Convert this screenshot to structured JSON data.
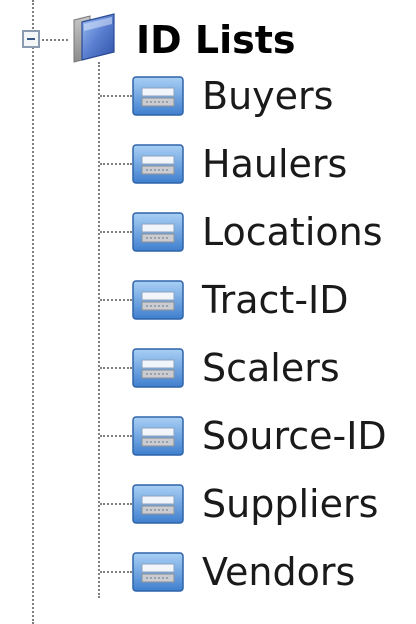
{
  "tree": {
    "root": {
      "label": "ID Lists",
      "icon": "folder-icon",
      "expanded": true
    },
    "items": [
      {
        "label": "Buyers",
        "icon": "list-icon"
      },
      {
        "label": "Haulers",
        "icon": "list-icon"
      },
      {
        "label": "Locations",
        "icon": "list-icon"
      },
      {
        "label": "Tract-ID",
        "icon": "list-icon"
      },
      {
        "label": "Scalers",
        "icon": "list-icon"
      },
      {
        "label": "Source-ID",
        "icon": "list-icon"
      },
      {
        "label": "Suppliers",
        "icon": "list-icon"
      },
      {
        "label": "Vendors",
        "icon": "list-icon"
      }
    ]
  },
  "colors": {
    "connector": "#7f7f7f",
    "folder": "#5a7fd0",
    "list_icon": "#4f8fd8"
  }
}
